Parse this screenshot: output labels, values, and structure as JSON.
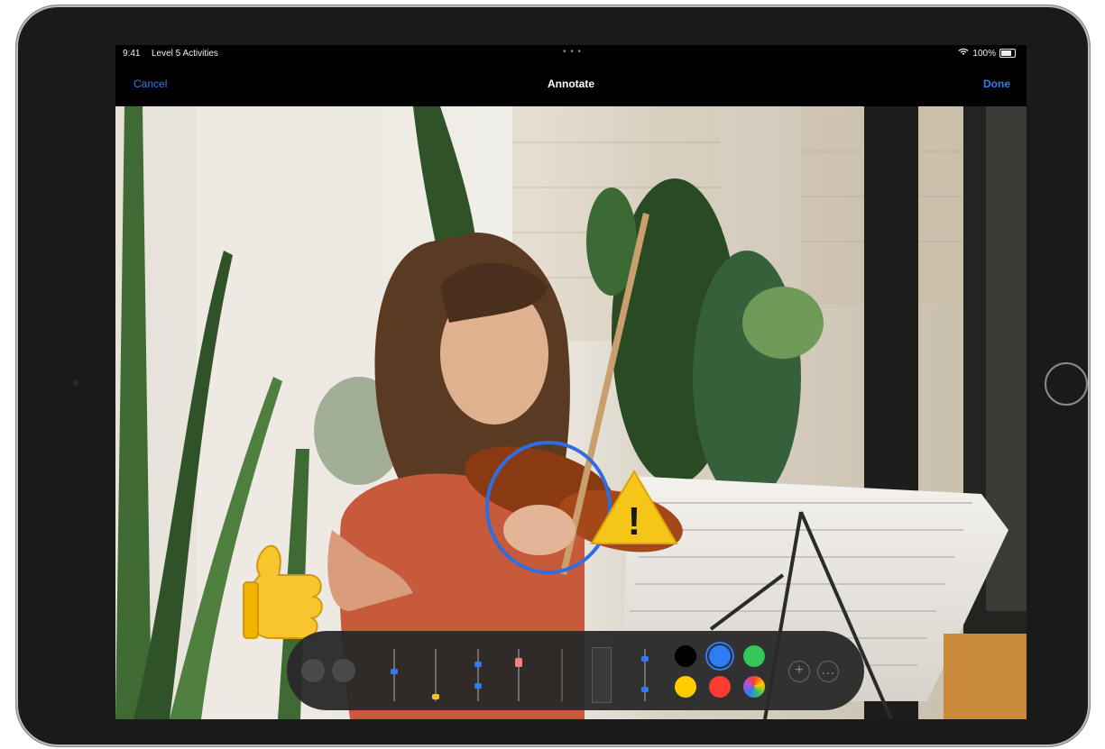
{
  "status_bar": {
    "time": "9:41",
    "carrier": "Level 5 Activities",
    "center_dots": "• • •",
    "right_text": "100%"
  },
  "nav": {
    "cancel_label": "Cancel",
    "title": "Annotate",
    "done_label": "Done"
  },
  "photo": {
    "callout_exclamation": "!"
  },
  "toolbar": {
    "undo_icon": "undo-icon",
    "redo_icon": "redo-icon",
    "tools": [
      "pen",
      "marker",
      "pencil",
      "eraser",
      "lasso",
      "ruler",
      "pen"
    ],
    "colors": [
      "#000000",
      "#2f7bf5",
      "#34c759",
      "#ffcc00",
      "#ff3b30",
      "spectrum"
    ],
    "selected_color": "#2f7bf5",
    "add_label": "+",
    "more_label": "…"
  }
}
